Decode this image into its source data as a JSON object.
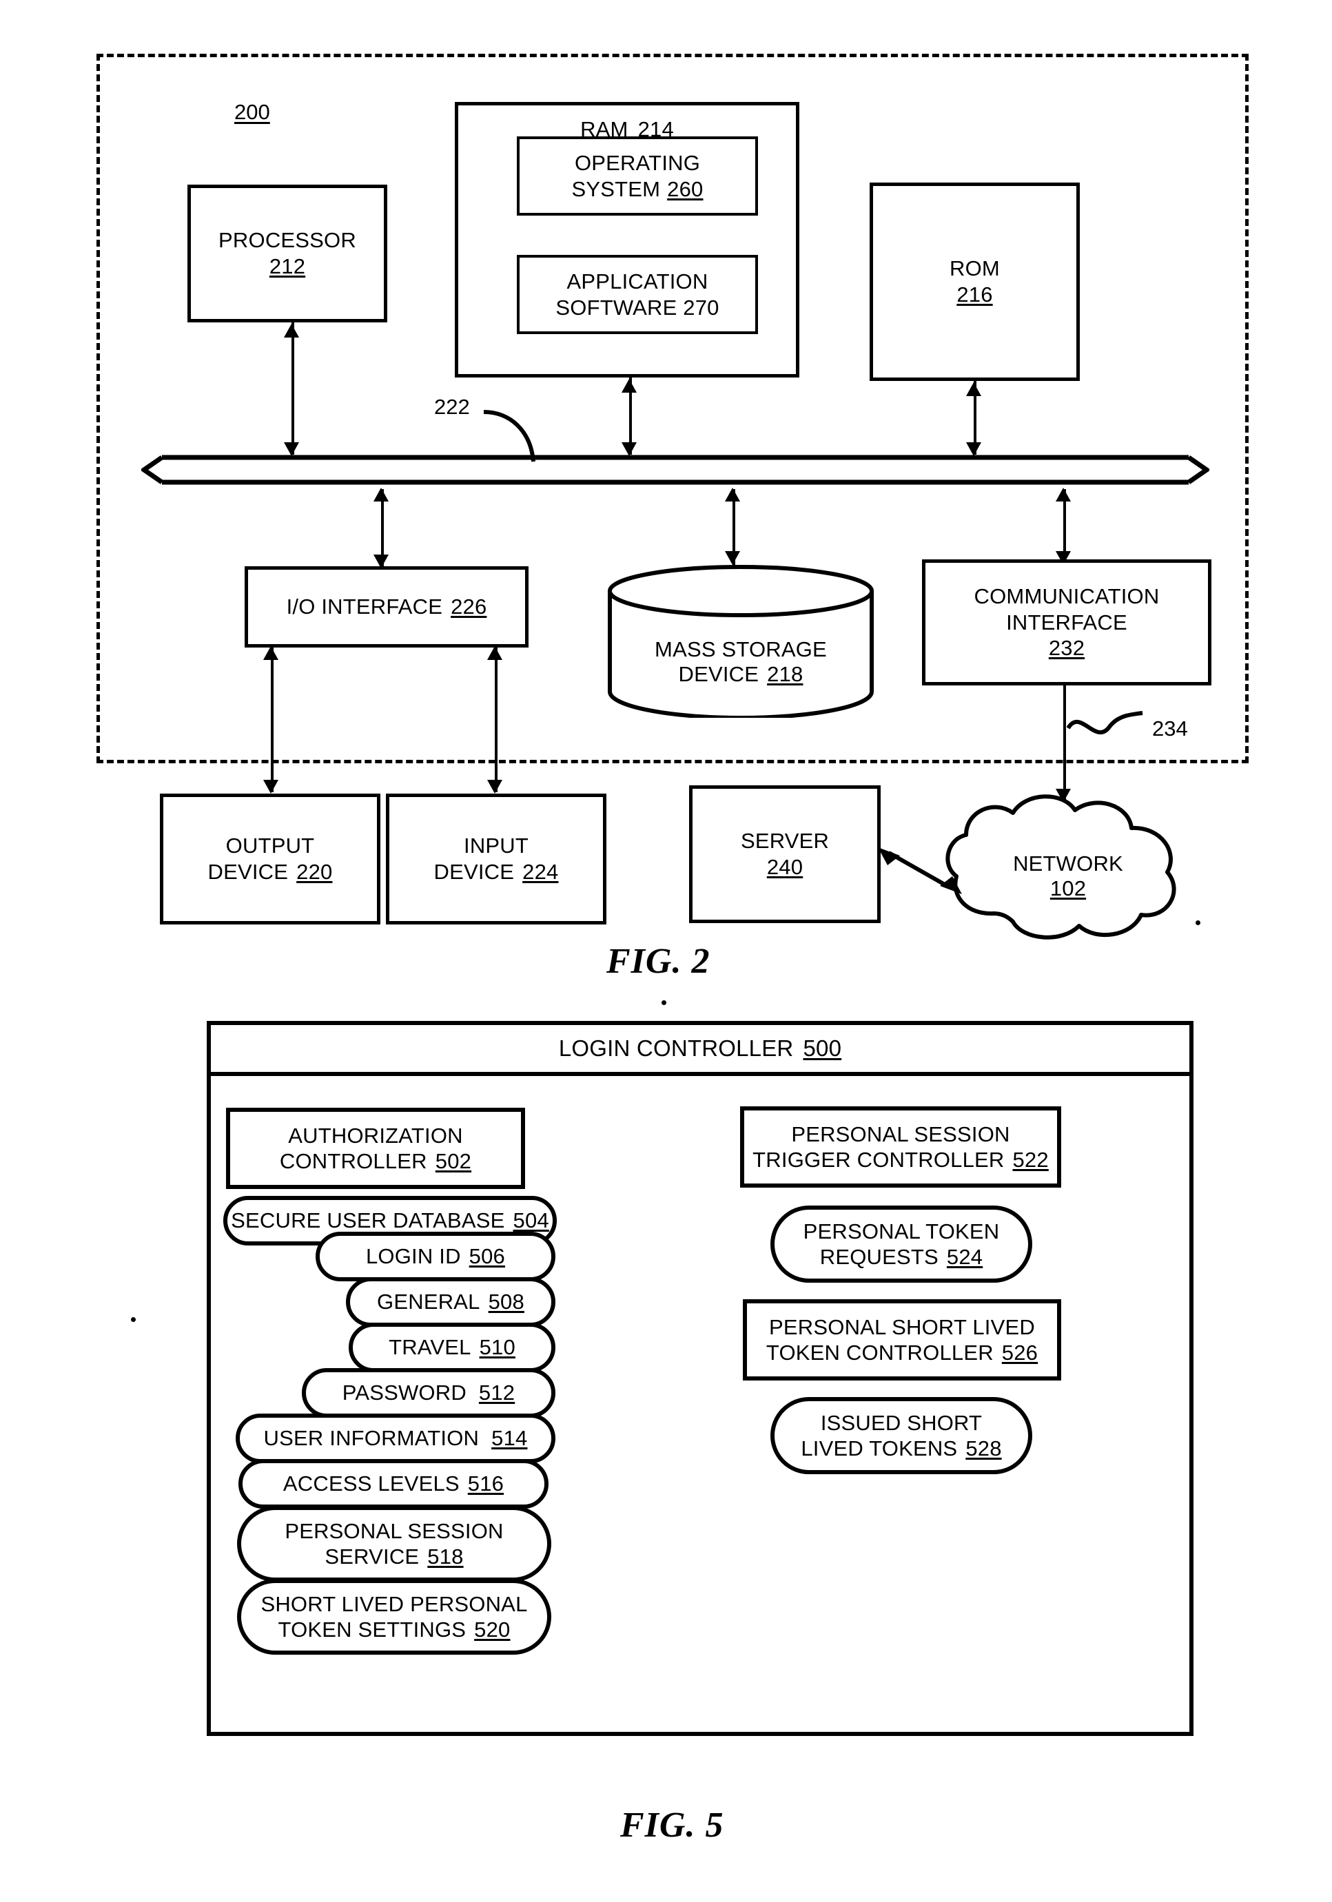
{
  "figures": [
    {
      "caption": "FIG. 2"
    },
    {
      "caption": "FIG. 5"
    }
  ],
  "fig2": {
    "caption": "FIG. 2",
    "system_ref": "200",
    "bus_ref": "222",
    "link_ref": "234",
    "blocks": {
      "processor": {
        "line1": "PROCESSOR",
        "line2": "212"
      },
      "ram": {
        "line1": "RAM",
        "ref": "214"
      },
      "operating_system": {
        "line1": "OPERATING",
        "line2": "SYSTEM",
        "ref": "260"
      },
      "application_software": {
        "line1": "APPLICATION",
        "line2": "SOFTWARE 270"
      },
      "rom": {
        "line1": "ROM",
        "line2": "216"
      },
      "io_interface": {
        "line1": "I/O INTERFACE",
        "ref": "226"
      },
      "mass_storage": {
        "line1": "MASS STORAGE",
        "line2": "DEVICE",
        "ref": "218"
      },
      "communication_interface": {
        "line1": "COMMUNICATION",
        "line2": "INTERFACE",
        "line3": "232"
      },
      "output_device": {
        "line1": "OUTPUT",
        "line2": "DEVICE",
        "ref": "220"
      },
      "input_device": {
        "line1": "INPUT",
        "line2": "DEVICE",
        "ref": "224"
      },
      "server": {
        "line1": "SERVER",
        "line2": "240"
      },
      "network": {
        "line1": "NETWORK",
        "line2": "102"
      }
    }
  },
  "fig5": {
    "caption": "FIG. 5",
    "title": {
      "text": "LOGIN CONTROLLER",
      "ref": "500"
    },
    "left_column": [
      {
        "shape": "box",
        "name": "authorization-controller",
        "line1": "AUTHORIZATION",
        "line2": "CONTROLLER",
        "ref": "502"
      },
      {
        "shape": "oval",
        "name": "secure-user-database",
        "line1": "SECURE USER DATABASE",
        "ref": "504"
      },
      {
        "shape": "oval",
        "name": "login-id",
        "line1": "LOGIN ID",
        "ref": "506"
      },
      {
        "shape": "oval",
        "name": "general",
        "line1": "GENERAL",
        "ref": "508"
      },
      {
        "shape": "oval",
        "name": "travel",
        "line1": "TRAVEL",
        "ref": "510"
      },
      {
        "shape": "oval",
        "name": "password",
        "line1": "PASSWORD",
        "ref": "512"
      },
      {
        "shape": "oval",
        "name": "user-information",
        "line1": "USER INFORMATION",
        "ref": "514"
      },
      {
        "shape": "oval",
        "name": "access-levels",
        "line1": "ACCESS LEVELS",
        "ref": "516"
      },
      {
        "shape": "oval",
        "name": "personal-session-service",
        "line1": "PERSONAL SESSION",
        "line2": "SERVICE",
        "ref": "518"
      },
      {
        "shape": "oval",
        "name": "short-lived-personal-token-settings",
        "line1": "SHORT LIVED PERSONAL",
        "line2": "TOKEN SETTINGS",
        "ref": "520"
      }
    ],
    "right_column": [
      {
        "shape": "box",
        "name": "personal-session-trigger-controller",
        "line1": "PERSONAL SESSION",
        "line2": "TRIGGER CONTROLLER",
        "ref": "522"
      },
      {
        "shape": "oval",
        "name": "personal-token-requests",
        "line1": "PERSONAL TOKEN",
        "line2": "REQUESTS",
        "ref": "524"
      },
      {
        "shape": "box",
        "name": "personal-short-lived-token-controller",
        "line1": "PERSONAL SHORT LIVED",
        "line2": "TOKEN CONTROLLER",
        "ref": "526"
      },
      {
        "shape": "oval",
        "name": "issued-short-lived-tokens",
        "line1": "ISSUED SHORT",
        "line2": "LIVED TOKENS",
        "ref": "528"
      }
    ]
  }
}
